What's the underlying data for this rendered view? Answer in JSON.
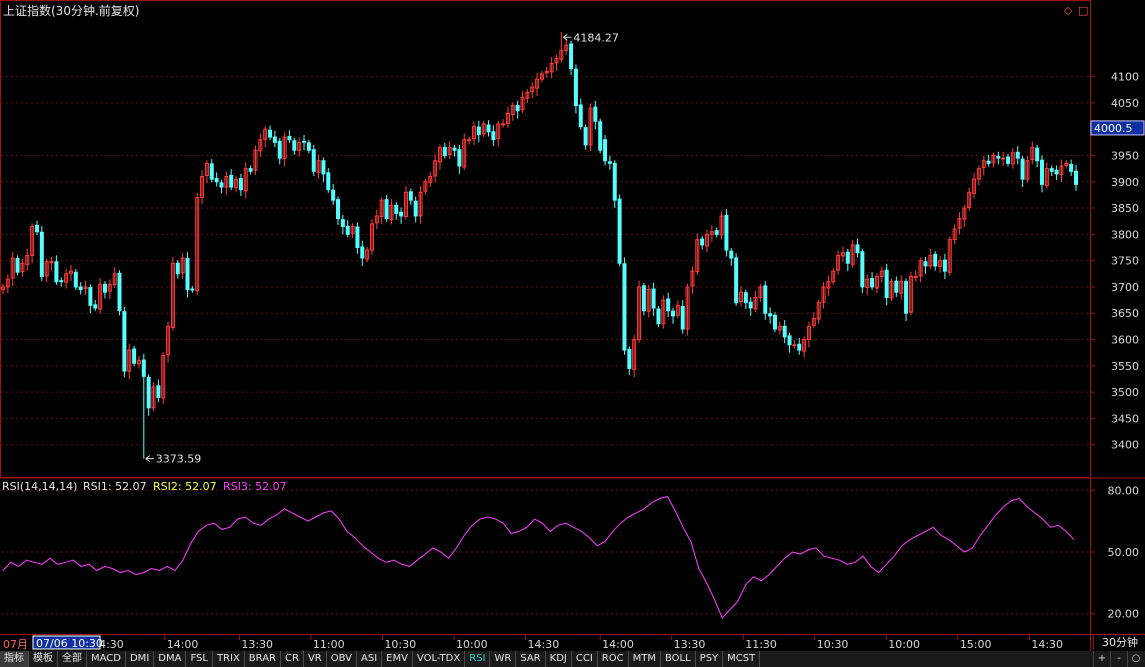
{
  "title": "上证指数(30分钟.前复权)",
  "window_controls": {
    "restore": "◇",
    "close": "□"
  },
  "colors": {
    "up": "#ff3b3b",
    "down": "#54ffff",
    "frame": "#a01010",
    "grid": "#5a1010",
    "rsi3": "#ff40ff",
    "rsi_label": "#e6e6e6",
    "rsi1_label": "#e6e6e6",
    "rsi2_label": "#ffff40",
    "axis_text": "#d8d8d8"
  },
  "chart_data": [
    {
      "type": "candlestick",
      "name": "上证指数",
      "ylim": [
        3350,
        4200
      ],
      "y_ticks": [
        4100,
        4050,
        3950,
        3900,
        3850,
        3800,
        3750,
        3700,
        3650,
        3600,
        3550,
        3500,
        3450,
        3400
      ],
      "current_value": "4000.5",
      "current_value_level": 4000.5,
      "annotations": [
        {
          "text": "4184.27",
          "value": 4184.27,
          "x_index": 115
        },
        {
          "text": "3373.59",
          "value": 3373.59,
          "x_index": 29
        }
      ],
      "closes": [
        3700,
        3715,
        3755,
        3728,
        3745,
        3760,
        3815,
        3805,
        3720,
        3748,
        3748,
        3710,
        3710,
        3725,
        3730,
        3700,
        3695,
        3700,
        3665,
        3660,
        3705,
        3690,
        3705,
        3725,
        3655,
        3540,
        3580,
        3555,
        3560,
        3530,
        3470,
        3510,
        3490,
        3570,
        3625,
        3745,
        3725,
        3755,
        3695,
        3695,
        3870,
        3910,
        3935,
        3905,
        3900,
        3890,
        3910,
        3890,
        3905,
        3885,
        3925,
        3920,
        3960,
        3980,
        4000,
        3985,
        3975,
        3945,
        3985,
        3980,
        3960,
        3975,
        3975,
        3960,
        3920,
        3940,
        3915,
        3885,
        3865,
        3830,
        3815,
        3800,
        3815,
        3775,
        3755,
        3770,
        3820,
        3835,
        3865,
        3830,
        3855,
        3840,
        3835,
        3880,
        3865,
        3835,
        3880,
        3900,
        3910,
        3940,
        3965,
        3950,
        3965,
        3960,
        3930,
        3980,
        3980,
        4005,
        3990,
        4010,
        3995,
        3980,
        4010,
        4010,
        4030,
        4045,
        4035,
        4060,
        4070,
        4080,
        4095,
        4105,
        4110,
        4125,
        4135,
        4150,
        4160,
        4115,
        4045,
        4005,
        3970,
        4040,
        4015,
        3960,
        3940,
        3935,
        3865,
        3745,
        3580,
        3545,
        3600,
        3700,
        3655,
        3695,
        3660,
        3630,
        3675,
        3655,
        3645,
        3665,
        3620,
        3700,
        3730,
        3790,
        3780,
        3800,
        3805,
        3800,
        3835,
        3770,
        3755,
        3670,
        3690,
        3670,
        3660,
        3680,
        3700,
        3650,
        3645,
        3620,
        3625,
        3605,
        3590,
        3590,
        3580,
        3600,
        3625,
        3640,
        3670,
        3700,
        3710,
        3730,
        3760,
        3765,
        3745,
        3780,
        3765,
        3700,
        3715,
        3700,
        3720,
        3730,
        3680,
        3710,
        3690,
        3710,
        3650,
        3720,
        3720,
        3750,
        3740,
        3760,
        3740,
        3750,
        3730,
        3790,
        3810,
        3830,
        3850,
        3880,
        3905,
        3925,
        3940,
        3935,
        3950,
        3945,
        3945,
        3935,
        3955,
        3945,
        3905,
        3940,
        3965,
        3940,
        3895,
        3925,
        3920,
        3915,
        3930,
        3935,
        3920,
        3895
      ],
      "x_labels": [
        "07月",
        "14:30",
        "14:00",
        "13:30",
        "11:00",
        "10:30",
        "10:00",
        "14:30",
        "14:00",
        "13:30",
        "11:30",
        "10:30",
        "10:00",
        "15:00",
        "14:30"
      ],
      "x_label_index": [
        0,
        28,
        52,
        76,
        99,
        122,
        145,
        168,
        192,
        215,
        238,
        261,
        284,
        307,
        330
      ],
      "cursor_label": "07/06 10:30"
    },
    {
      "type": "line",
      "name": "RSI(14,14,14)",
      "legend": [
        {
          "text": "RSI(14,14,14)",
          "key": "rsi_label"
        },
        {
          "text": "RSI1: 52.07",
          "key": "rsi1_label"
        },
        {
          "text": "RSI2: 52.07",
          "key": "rsi2_label"
        },
        {
          "text": "RSI3: 52.07",
          "key": "rsi3"
        }
      ],
      "ylim": [
        15,
        85
      ],
      "y_ticks": [
        80.0,
        50.0,
        20.0
      ],
      "values": [
        41,
        45,
        43,
        46,
        45,
        44,
        47,
        44,
        45,
        46,
        43,
        44,
        41,
        43,
        42,
        40,
        41,
        39,
        40,
        42,
        41,
        43,
        41,
        46,
        54,
        60,
        63,
        64,
        61,
        62,
        66,
        67,
        64,
        63,
        66,
        68,
        71,
        69,
        67,
        65,
        67,
        69,
        70,
        66,
        60,
        57,
        53,
        50,
        47,
        45,
        46,
        44,
        43,
        46,
        49,
        52,
        50,
        47,
        52,
        58,
        63,
        66,
        67,
        66,
        64,
        59,
        60,
        62,
        66,
        64,
        60,
        63,
        64,
        62,
        60,
        57,
        53,
        55,
        60,
        64,
        67,
        69,
        71,
        74,
        76,
        77,
        70,
        62,
        55,
        42,
        35,
        27,
        18,
        22,
        26,
        34,
        38,
        36,
        39,
        43,
        47,
        50,
        49,
        51,
        52,
        48,
        47,
        46,
        44,
        45,
        48,
        43,
        40,
        44,
        48,
        53,
        56,
        58,
        60,
        62,
        58,
        56,
        53,
        50,
        52,
        58,
        63,
        68,
        72,
        75,
        76,
        72,
        69,
        66,
        62,
        63,
        60,
        56
      ],
      "current": 52.07
    }
  ],
  "tabs": [
    "指标",
    "模板",
    "全部",
    "MACD",
    "DMI",
    "DMA",
    "FSL",
    "TRIX",
    "BRAR",
    "CR",
    "VR",
    "OBV",
    "ASI",
    "EMV",
    "VOL-TDX",
    "RSI",
    "WR",
    "SAR",
    "KDJ",
    "CCI",
    "ROC",
    "MTM",
    "BOLL",
    "PSY",
    "MCST"
  ],
  "active_tab": "RSI",
  "period": "30分钟",
  "nav": {
    "plus": "+",
    "minus": "-",
    "fit": "○"
  }
}
